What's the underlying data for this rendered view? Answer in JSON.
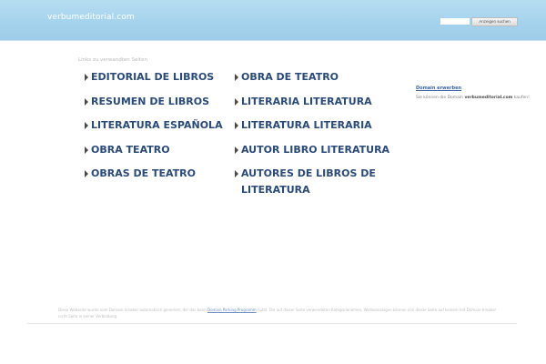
{
  "header": {
    "domain": "verbumeditorial.com",
    "search_placeholder": "",
    "search_button": "Anzeigen suchen"
  },
  "links": {
    "heading": "Links zu verwandten Seiten",
    "items": [
      {
        "label": "EDITORIAL DE LIBROS"
      },
      {
        "label": "OBRA DE TEATRO"
      },
      {
        "label": "RESUMEN DE LIBROS"
      },
      {
        "label": "LITERARIA LITERATURA"
      },
      {
        "label": "LITERATURA ESPAÑOLA"
      },
      {
        "label": "LITERATURA LITERARIA"
      },
      {
        "label": "OBRA TEATRO"
      },
      {
        "label": "AUTOR LIBRO LITERATURA"
      },
      {
        "label": "OBRAS DE TEATRO"
      },
      {
        "label": "AUTORES DE LIBROS DE LITERATURA"
      }
    ]
  },
  "sidebar": {
    "title": "Domain erwerben",
    "text_prefix": "Sie können die Domain ",
    "text_domain": "verbumeditorial.com",
    "text_suffix": " kaufen!"
  },
  "footer": {
    "disclaimer_prefix": "Diese Webseite wurde vom Domain-Inhaber automatisch generiert, der das beim ",
    "disclaimer_link": "Domain Parking Programm",
    "disclaimer_suffix": " nutzt. Die auf dieser Seite verwendeten Kategorienamen, Werbeanzeigen können von dieser Seite auf keinem mit Domain-Inhaber nicht Seite in keiner Verbindung."
  },
  "colors": {
    "header_bg": "#a4d2ec",
    "link": "#2a4a78",
    "sidebar_link": "#3a66a8"
  }
}
